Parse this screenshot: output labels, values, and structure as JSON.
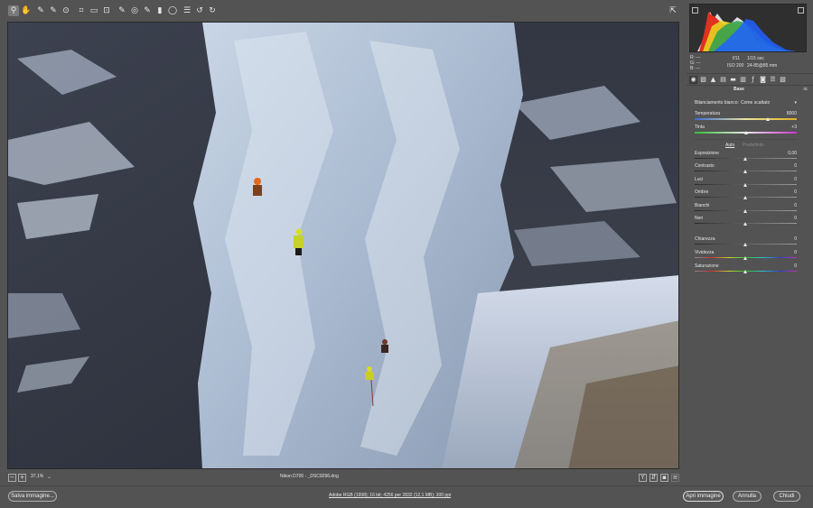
{
  "toolbar": {
    "tools": [
      {
        "name": "zoom-tool",
        "glyph": "⚲"
      },
      {
        "name": "hand-tool",
        "glyph": "✋"
      },
      {
        "name": "white-balance-tool",
        "glyph": "✎"
      },
      {
        "name": "color-sampler-tool",
        "glyph": "✎"
      },
      {
        "name": "targeted-adjustment-tool",
        "glyph": "⊙"
      },
      {
        "name": "crop-tool",
        "glyph": "⌗"
      },
      {
        "name": "straighten-tool",
        "glyph": "▭"
      },
      {
        "name": "transform-tool",
        "glyph": "⊡"
      },
      {
        "name": "spot-removal-tool",
        "glyph": "✎"
      },
      {
        "name": "red-eye-tool",
        "glyph": "◎"
      },
      {
        "name": "adjustment-brush-tool",
        "glyph": "✎"
      },
      {
        "name": "graduated-filter-tool",
        "glyph": "▮"
      },
      {
        "name": "radial-filter-tool",
        "glyph": "◯"
      },
      {
        "name": "preferences-tool",
        "glyph": "☰"
      },
      {
        "name": "rotate-left-tool",
        "glyph": "↺"
      },
      {
        "name": "rotate-right-tool",
        "glyph": "↻"
      }
    ],
    "fullscreen_glyph": "⇱"
  },
  "meta": {
    "r_label": "R:",
    "g_label": "G:",
    "b_label": "B:",
    "r_value": "---",
    "g_value": "---",
    "b_value": "---",
    "aperture": "f/11",
    "shutter": "1/15 sec",
    "iso": "ISO 200",
    "lens": "24-85@85 mm"
  },
  "panel": {
    "section_title": "Base",
    "wb_label": "Bilanciamento bianco:",
    "wb_value": "Come scattato",
    "temperature": {
      "label": "Temperatura",
      "value": "8000",
      "level": 0.72
    },
    "tint": {
      "label": "Tinta",
      "value": "+3",
      "level": 0.51
    },
    "auto_label": "Auto",
    "default_label": "Predefinito",
    "sliders": [
      {
        "key": "exposure",
        "label": "Esposizione",
        "value": "0,00",
        "level": 0.5
      },
      {
        "key": "contrast",
        "label": "Contrasto",
        "value": "0",
        "level": 0.5
      },
      {
        "key": "highlights",
        "label": "Luci",
        "value": "0",
        "level": 0.5
      },
      {
        "key": "shadows",
        "label": "Ombre",
        "value": "0",
        "level": 0.5
      },
      {
        "key": "whites",
        "label": "Bianchi",
        "value": "0",
        "level": 0.5
      },
      {
        "key": "blacks",
        "label": "Neri",
        "value": "0",
        "level": 0.5
      },
      {
        "key": "clarity",
        "label": "Chiarezza",
        "value": "0",
        "level": 0.5
      },
      {
        "key": "vibrance",
        "label": "Vividezza",
        "value": "0",
        "level": 0.5
      },
      {
        "key": "saturation",
        "label": "Saturazione",
        "value": "0",
        "level": 0.5
      }
    ]
  },
  "status": {
    "zoom": "37,1%",
    "filename": "Nikon D700  -  _DSC9296.dng"
  },
  "bottom": {
    "save_label": "Salva immagine...",
    "workflow_link": "Adobe RGB (1998); 16 bit; 4256 per 2832 (12,1 MB); 300 ppi",
    "open_label": "Apri immagine",
    "cancel_label": "Annulla",
    "done_label": "Chiudi"
  },
  "colors": {
    "background": "#535353",
    "histogram_bg": "#2f2f2f",
    "accent_red": "#e03020",
    "accent_blue": "#2060ff"
  }
}
